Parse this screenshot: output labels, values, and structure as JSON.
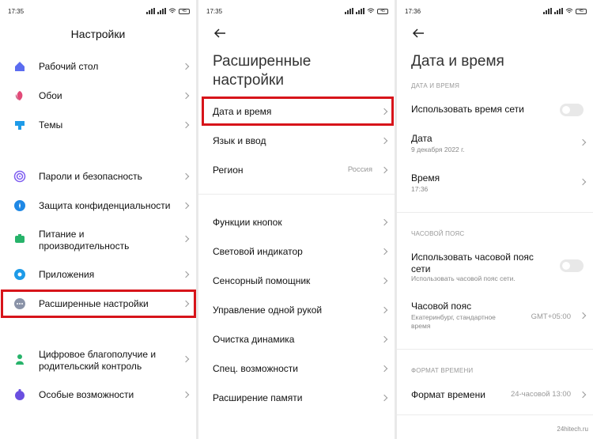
{
  "colors": {
    "highlight": "#d7141a",
    "background": "#ffffff"
  },
  "screen1": {
    "time": "17:35",
    "battery": "45",
    "title": "Настройки",
    "items": [
      {
        "label": "Рабочий стол",
        "icon": "home-icon"
      },
      {
        "label": "Обои",
        "icon": "wallpaper-icon"
      },
      {
        "label": "Темы",
        "icon": "themes-icon"
      },
      {
        "label": "Пароли и безопасность",
        "icon": "fingerprint-icon"
      },
      {
        "label": "Защита конфиденциальности",
        "icon": "privacy-icon"
      },
      {
        "label": "Питание и\nпроизводительность",
        "icon": "battery-icon"
      },
      {
        "label": "Приложения",
        "icon": "apps-icon"
      },
      {
        "label": "Расширенные настройки",
        "icon": "more-icon"
      },
      {
        "label": "Цифровое благополучие и\nродительский контроль",
        "icon": "wellbeing-icon"
      },
      {
        "label": "Особые возможности",
        "icon": "accessibility-icon"
      }
    ]
  },
  "screen2": {
    "time": "17:35",
    "battery": "45",
    "title": "Расширенные\nнастройки",
    "items": [
      {
        "label": "Дата и время"
      },
      {
        "label": "Язык и ввод"
      },
      {
        "label": "Регион",
        "value": "Россия"
      },
      {
        "label": "Функции кнопок"
      },
      {
        "label": "Световой индикатор"
      },
      {
        "label": "Сенсорный помощник"
      },
      {
        "label": "Управление одной рукой"
      },
      {
        "label": "Очистка динамика"
      },
      {
        "label": "Спец. возможности"
      },
      {
        "label": "Расширение памяти"
      }
    ]
  },
  "screen3": {
    "time": "17:36",
    "battery": "45",
    "title": "Дата и время",
    "section_datetime": "ДАТА И ВРЕМЯ",
    "network_time": "Использовать время сети",
    "date_label": "Дата",
    "date_value": "9 декабря 2022 г.",
    "time_label": "Время",
    "time_value": "17:36",
    "section_timezone": "ЧАСОВОЙ ПОЯС",
    "network_tz": "Использовать часовой пояс\nсети",
    "network_tz_sub": "Использовать часовой пояс сети.",
    "tz_label": "Часовой пояс",
    "tz_sub": "Екатеринбург, стандартное\nвремя",
    "tz_value": "GMT+05:00",
    "section_format": "ФОРМАТ ВРЕМЕНИ",
    "format_label": "Формат времени",
    "format_value": "24-часовой 13:00"
  },
  "watermark": "24hitech.ru"
}
